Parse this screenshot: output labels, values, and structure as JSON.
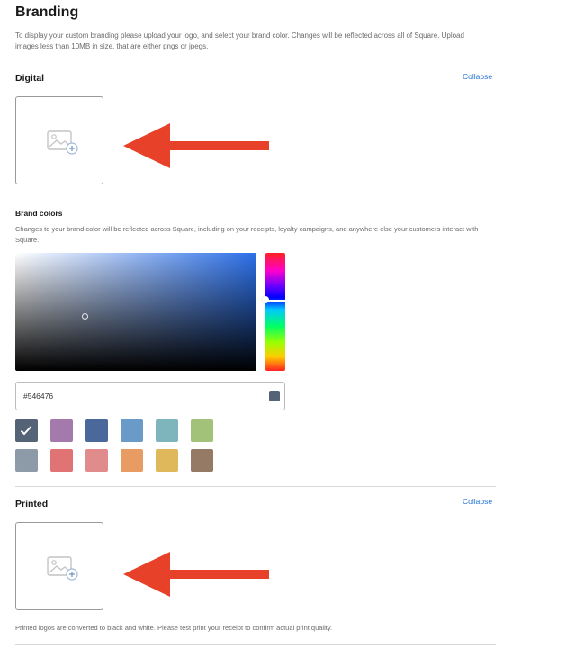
{
  "page": {
    "title": "Branding",
    "intro": "To display your custom branding please upload your logo, and select your brand color. Changes will be reflected across all of Square. Upload images less than 10MB in size, that are either pngs or jpegs."
  },
  "digital": {
    "title": "Digital",
    "collapse_label": "Collapse"
  },
  "brand_colors": {
    "title": "Brand colors",
    "description": "Changes to your brand color will be reflected across Square, including on your receipts, loyalty campaigns, and anywhere else your customers interact with Square.",
    "hex_value": "#546476",
    "selected_color": "#546476",
    "swatches_row1": [
      "#546476",
      "#a47aac",
      "#4a6899",
      "#6a9ac8",
      "#7eb5bd",
      "#a2c27a"
    ],
    "swatches_row2": [
      "#8d9aa8",
      "#e07373",
      "#e08c8c",
      "#e89c63",
      "#e0b85c",
      "#957b66"
    ]
  },
  "printed": {
    "title": "Printed",
    "collapse_label": "Collapse",
    "note": "Printed logos are converted to black and white. Please test print your receipt to confirm actual print quality."
  },
  "icons": {
    "upload": "image-add-icon",
    "check": "checkmark-icon",
    "annotation": "red-arrow-icon"
  },
  "colors": {
    "link": "#2673d6",
    "arrow": "#e8412a",
    "border": "#9a9a9a"
  }
}
